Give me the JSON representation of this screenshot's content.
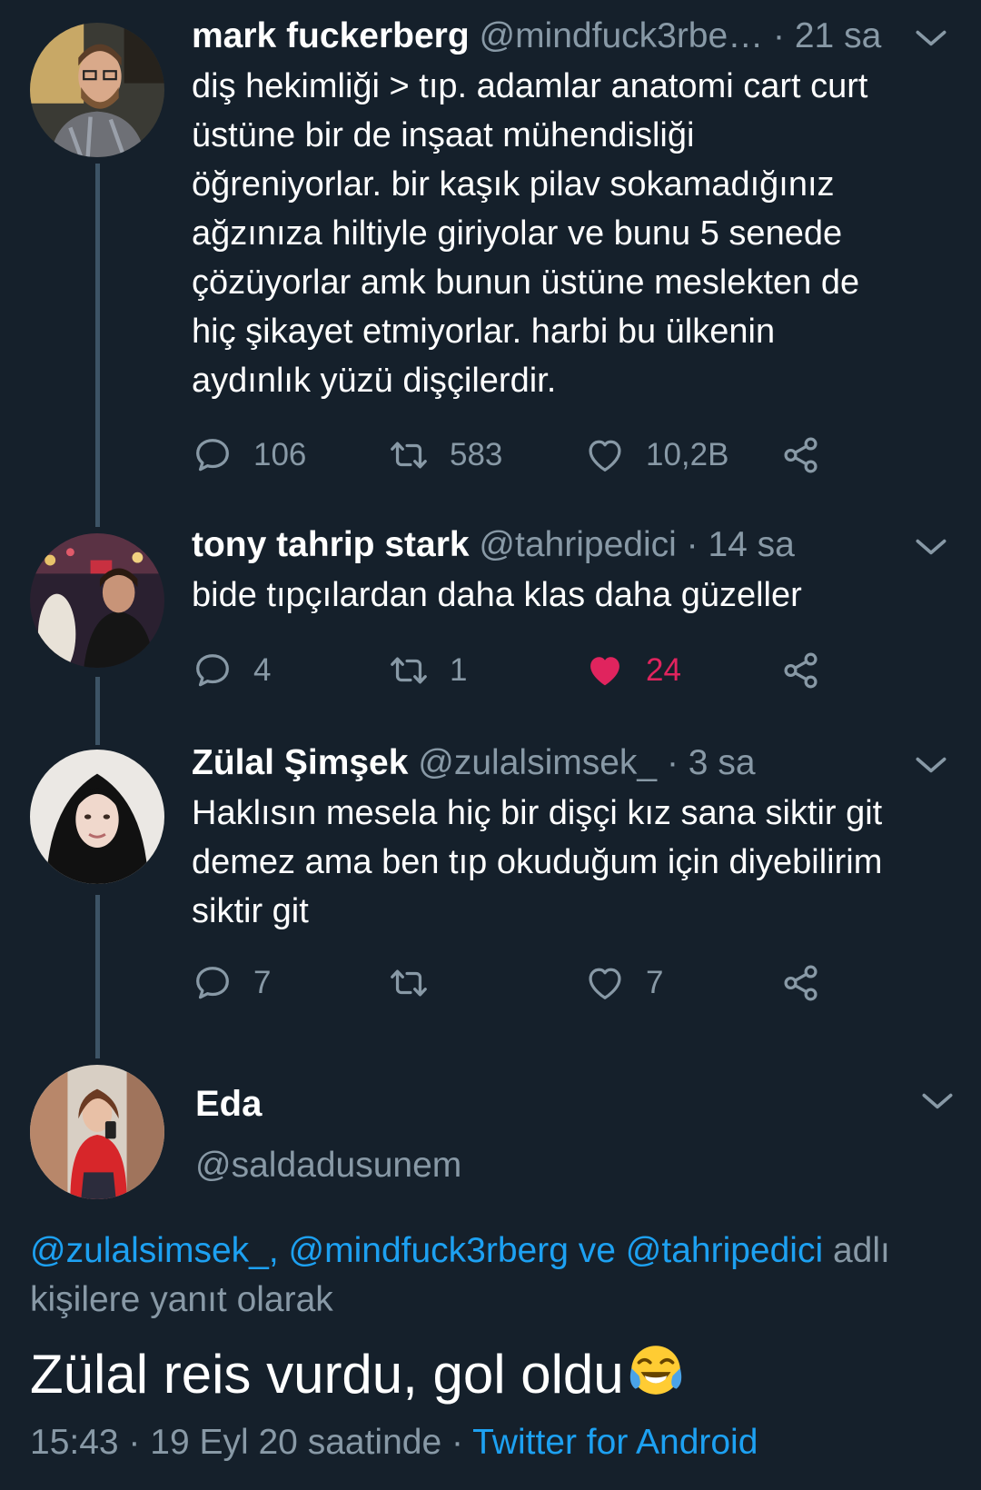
{
  "colors": {
    "background": "#15202b",
    "secondary_text": "#8899a6",
    "link": "#1da1f2",
    "like_active": "#e0245e",
    "thread_line": "#3d5466"
  },
  "tweets": [
    {
      "name": "mark fuckerberg",
      "handle": "@mindfuck3rbe…",
      "time": "· 21 sa",
      "text_lines": [
        "diş hekimliği > tıp. adamlar anatomi cart curt",
        "üstüne bir de inşaat mühendisliği",
        "öğreniyorlar. bir kaşık pilav sokamadığınız",
        "ağzınıza hiltiyle giriyolar ve bunu 5 senede",
        "çözüyorlar amk bunun üstüne meslekten de",
        "hiç şikayet etmiyorlar. harbi bu ülkenin",
        "aydınlık yüzü dişçilerdir."
      ],
      "replies": "106",
      "retweets": "583",
      "likes": "10,2B",
      "liked": false
    },
    {
      "name": "tony tahrip stark",
      "handle": "@tahripedici",
      "time": "· 14 sa",
      "text_lines": [
        "bide tıpçılardan daha klas daha güzeller"
      ],
      "replies": "4",
      "retweets": "1",
      "likes": "24",
      "liked": true
    },
    {
      "name": "Zülal Şimşek",
      "handle": "@zulalsimsek_",
      "time": "· 3 sa",
      "text_lines": [
        "Haklısın mesela hiç bir dişçi kız sana siktir git",
        "demez ama ben tıp okuduğum için diyebilirim",
        "siktir git"
      ],
      "replies": "7",
      "retweets": "",
      "likes": "7",
      "liked": false
    }
  ],
  "main_tweet": {
    "name": "Eda",
    "handle": "@saldadusunem",
    "reply_to": {
      "mention1": "@zulalsimsek_",
      "sep1": ", ",
      "mention2": "@mindfuck3rberg",
      "sep2": " ve ",
      "mention3": "@tahripedici",
      "suffix": " adlı kişilere yanıt olarak"
    },
    "text": "Zülal reis vurdu, gol oldu",
    "emoji": "face-with-tears-of-joy",
    "time": "15:43 · 19 Eyl 20 saatinde · ",
    "source": "Twitter for Android"
  }
}
